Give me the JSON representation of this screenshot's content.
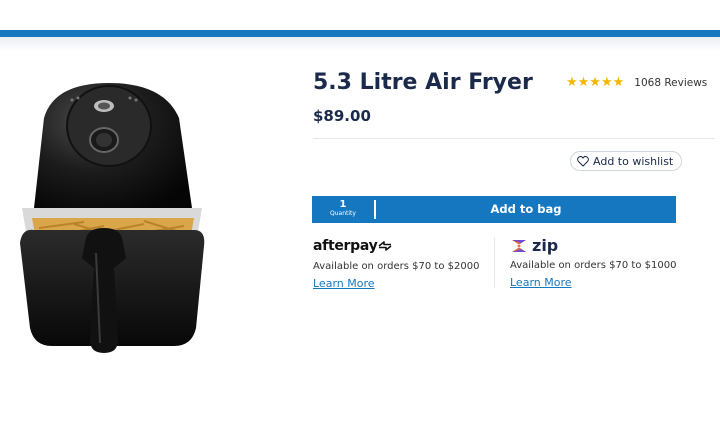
{
  "product": {
    "title": "5.3 Litre Air Fryer",
    "price": "$89.00",
    "rating_stars": "★★★★★",
    "reviews": "1068 Reviews",
    "image_alt": "air-fryer"
  },
  "actions": {
    "wishlist_label": "Add to wishlist",
    "quantity_value": "1",
    "quantity_label": "Quantity",
    "add_to_bag_label": "Add to bag"
  },
  "payments": {
    "afterpay": {
      "brand": "afterpay",
      "text": "Available on orders $70 to $2000",
      "link": "Learn More"
    },
    "zip": {
      "brand": "zip",
      "text": "Available on orders $70 to $1000",
      "link": "Learn More"
    }
  },
  "colors": {
    "accent": "#1577c0",
    "star": "#f2b705",
    "heading": "#1b2a4a"
  }
}
